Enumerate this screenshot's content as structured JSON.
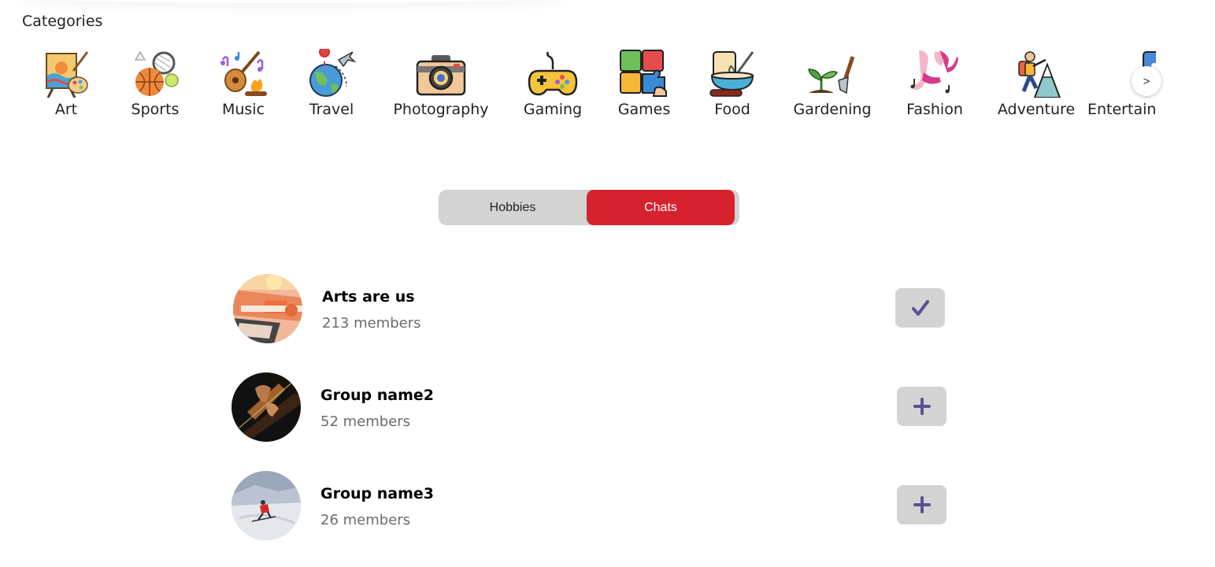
{
  "categories": {
    "title": "Categories",
    "items": [
      {
        "label": "Art",
        "icon": "easel-palette-icon"
      },
      {
        "label": "Sports",
        "icon": "sports-balls-icon"
      },
      {
        "label": "Music",
        "icon": "guitar-notes-icon"
      },
      {
        "label": "Travel",
        "icon": "globe-plane-icon"
      },
      {
        "label": "Photography",
        "icon": "camera-icon"
      },
      {
        "label": "Gaming",
        "icon": "gamepad-icon"
      },
      {
        "label": "Games",
        "icon": "puzzle-icon"
      },
      {
        "label": "Food",
        "icon": "mixing-bowl-icon"
      },
      {
        "label": "Gardening",
        "icon": "trowel-sprout-icon"
      },
      {
        "label": "Fashion",
        "icon": "high-heels-icon"
      },
      {
        "label": "Adventure",
        "icon": "climber-icon"
      },
      {
        "label": "Entertainment",
        "icon": "video-player-icon"
      }
    ],
    "scroll_next": ">"
  },
  "toggle": {
    "options": [
      "Hobbies",
      "Chats"
    ],
    "selected": "Chats",
    "active_color": "#d5222e"
  },
  "chats": [
    {
      "name": "Arts are us",
      "members": "213 members",
      "joined": true,
      "action_icon": "check-icon"
    },
    {
      "name": "Group name2",
      "members": "52 members",
      "joined": false,
      "action_icon": "plus-icon"
    },
    {
      "name": "Group name3",
      "members": "26 members",
      "joined": false,
      "action_icon": "plus-icon"
    }
  ],
  "colors": {
    "action_icon": "#5e4f92",
    "button_bg": "#d3d3d3",
    "muted_text": "#6b6b6b"
  }
}
